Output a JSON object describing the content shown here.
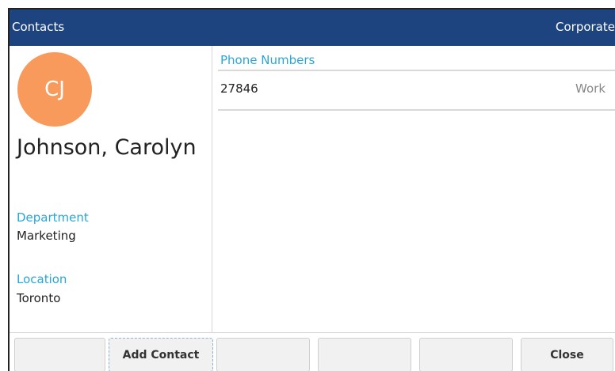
{
  "titlebar": {
    "title": "Contacts",
    "directory": "Corporate"
  },
  "contact": {
    "initials": "CJ",
    "avatar_color": "#f79a5c",
    "name": "Johnson, Carolyn",
    "department_label": "Department",
    "department": "Marketing",
    "location_label": "Location",
    "location": "Toronto"
  },
  "phones": {
    "section_label": "Phone Numbers",
    "items": [
      {
        "number": "27846",
        "type": "Work"
      }
    ]
  },
  "softkeys": [
    "",
    "Add Contact",
    "",
    "",
    "",
    "Close"
  ],
  "colors": {
    "header": "#1e4480",
    "accent": "#2aa6d6"
  }
}
